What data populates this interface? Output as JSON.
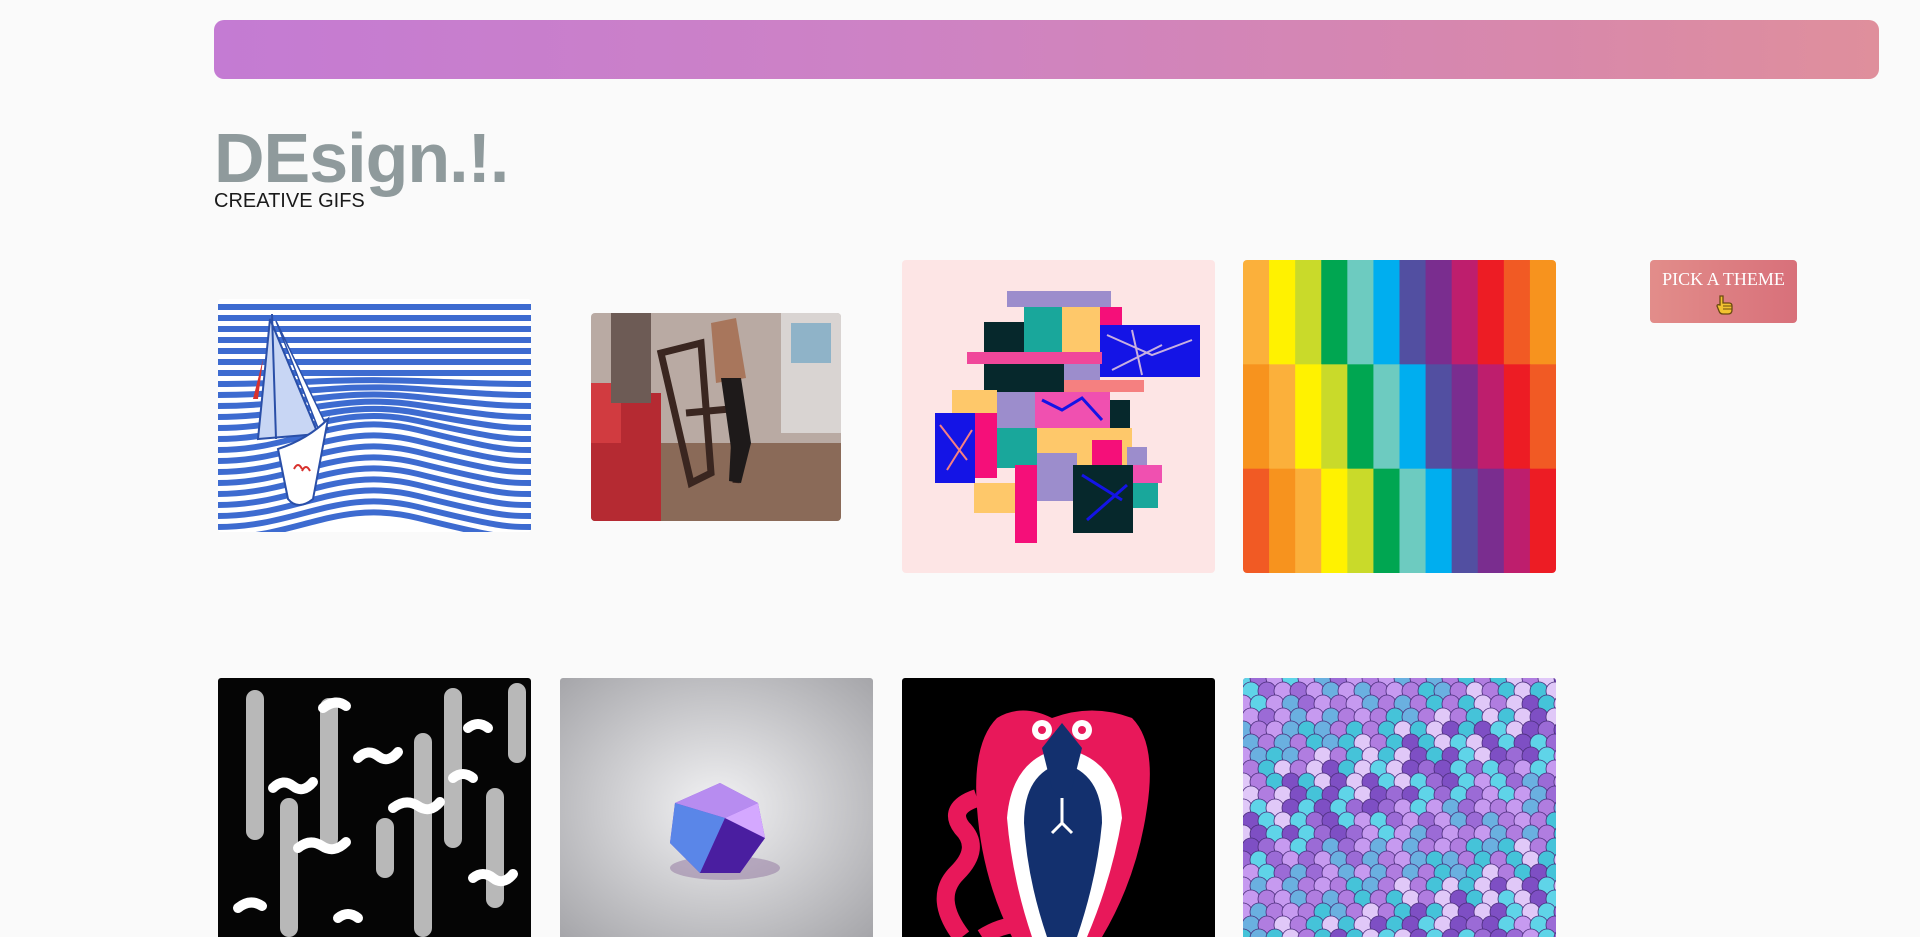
{
  "header": {
    "title": "DEsign.!.",
    "subtitle": "CREATIVE GIFS"
  },
  "theme_picker": {
    "label": "PICK A THEME",
    "icon": "pointing-hand-icon"
  },
  "colors": {
    "banner_start": "#c47bd3",
    "banner_end": "#df8f9c",
    "title": "#8f9a9c",
    "button_start": "#e28d8a",
    "button_end": "#d8707a"
  },
  "gallery": {
    "items": [
      {
        "name": "sailboat-waves-gif"
      },
      {
        "name": "person-chair-gif"
      },
      {
        "name": "abstract-collage-gif"
      },
      {
        "name": "rainbow-stripes-gif"
      },
      {
        "name": "falling-rain-gif"
      },
      {
        "name": "crystal-gem-gif"
      },
      {
        "name": "cobra-snake-gif"
      },
      {
        "name": "sequins-pattern-gif"
      }
    ]
  }
}
